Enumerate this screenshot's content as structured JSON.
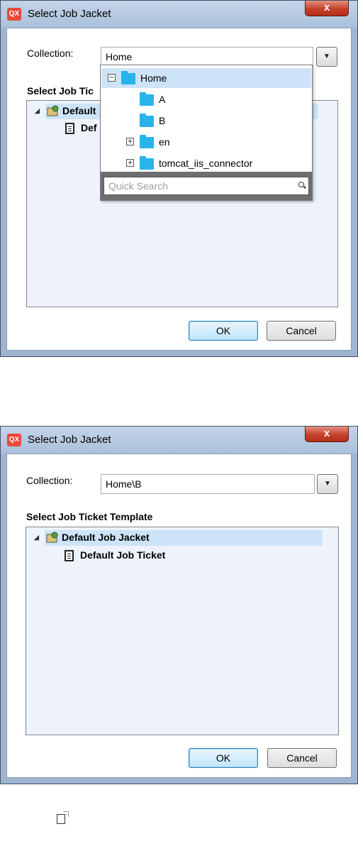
{
  "dialog1": {
    "title": "Select Job Jacket",
    "title_icon": "QX",
    "close_label": "x",
    "collection_label": "Collection:",
    "collection_value": "Home",
    "section_label": "Select Job Tic",
    "tree": {
      "jacket": "Default",
      "ticket": "Def"
    },
    "dropdown": {
      "items": [
        {
          "label": "Home",
          "expander": "minus"
        },
        {
          "label": "A",
          "expander": ""
        },
        {
          "label": "B",
          "expander": ""
        },
        {
          "label": "en",
          "expander": "plus"
        },
        {
          "label": "tomcat_iis_connector",
          "expander": "plus"
        }
      ],
      "search_placeholder": "Quick Search"
    },
    "ok_label": "OK",
    "cancel_label": "Cancel"
  },
  "dialog2": {
    "title": "Select Job Jacket",
    "title_icon": "QX",
    "close_label": "x",
    "collection_label": "Collection:",
    "collection_value": "Home\\B",
    "section_label": "Select Job Ticket Template",
    "tree": {
      "jacket": "Default Job Jacket",
      "ticket": "Default Job Ticket"
    },
    "ok_label": "OK",
    "cancel_label": "Cancel"
  },
  "colors": {
    "folder": "#27b4eb",
    "selection": "#cde3f8",
    "close_button": "#c7402b"
  }
}
